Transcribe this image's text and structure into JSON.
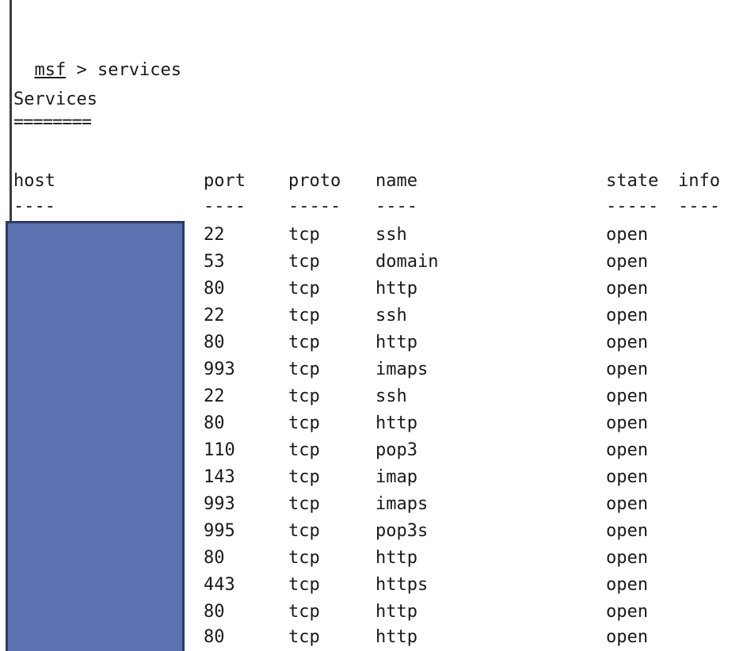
{
  "terminal": {
    "prompt_user": "msf",
    "prompt_rest": " > services",
    "heading": "Services",
    "heading_underline": "========",
    "redaction_color": "#5e72b1"
  },
  "table": {
    "headers": {
      "host": "host",
      "port": "port",
      "proto": "proto",
      "name": "name",
      "state": "state",
      "info": "info"
    },
    "separators": {
      "host": "----",
      "port": "----",
      "proto": "-----",
      "name": "----",
      "state": "-----",
      "info": "----"
    },
    "rows": [
      {
        "port": "22",
        "proto": "tcp",
        "name": "ssh",
        "state": "open"
      },
      {
        "port": "53",
        "proto": "tcp",
        "name": "domain",
        "state": "open"
      },
      {
        "port": "80",
        "proto": "tcp",
        "name": "http",
        "state": "open"
      },
      {
        "port": "22",
        "proto": "tcp",
        "name": "ssh",
        "state": "open"
      },
      {
        "port": "80",
        "proto": "tcp",
        "name": "http",
        "state": "open"
      },
      {
        "port": "993",
        "proto": "tcp",
        "name": "imaps",
        "state": "open"
      },
      {
        "port": "22",
        "proto": "tcp",
        "name": "ssh",
        "state": "open"
      },
      {
        "port": "80",
        "proto": "tcp",
        "name": "http",
        "state": "open"
      },
      {
        "port": "110",
        "proto": "tcp",
        "name": "pop3",
        "state": "open"
      },
      {
        "port": "143",
        "proto": "tcp",
        "name": "imap",
        "state": "open"
      },
      {
        "port": "993",
        "proto": "tcp",
        "name": "imaps",
        "state": "open"
      },
      {
        "port": "995",
        "proto": "tcp",
        "name": "pop3s",
        "state": "open"
      },
      {
        "port": "80",
        "proto": "tcp",
        "name": "http",
        "state": "open"
      },
      {
        "port": "443",
        "proto": "tcp",
        "name": "https",
        "state": "open"
      },
      {
        "port": "80",
        "proto": "tcp",
        "name": "http",
        "state": "open"
      },
      {
        "port": "80",
        "proto": "tcp",
        "name": "http",
        "state": "open"
      }
    ]
  }
}
